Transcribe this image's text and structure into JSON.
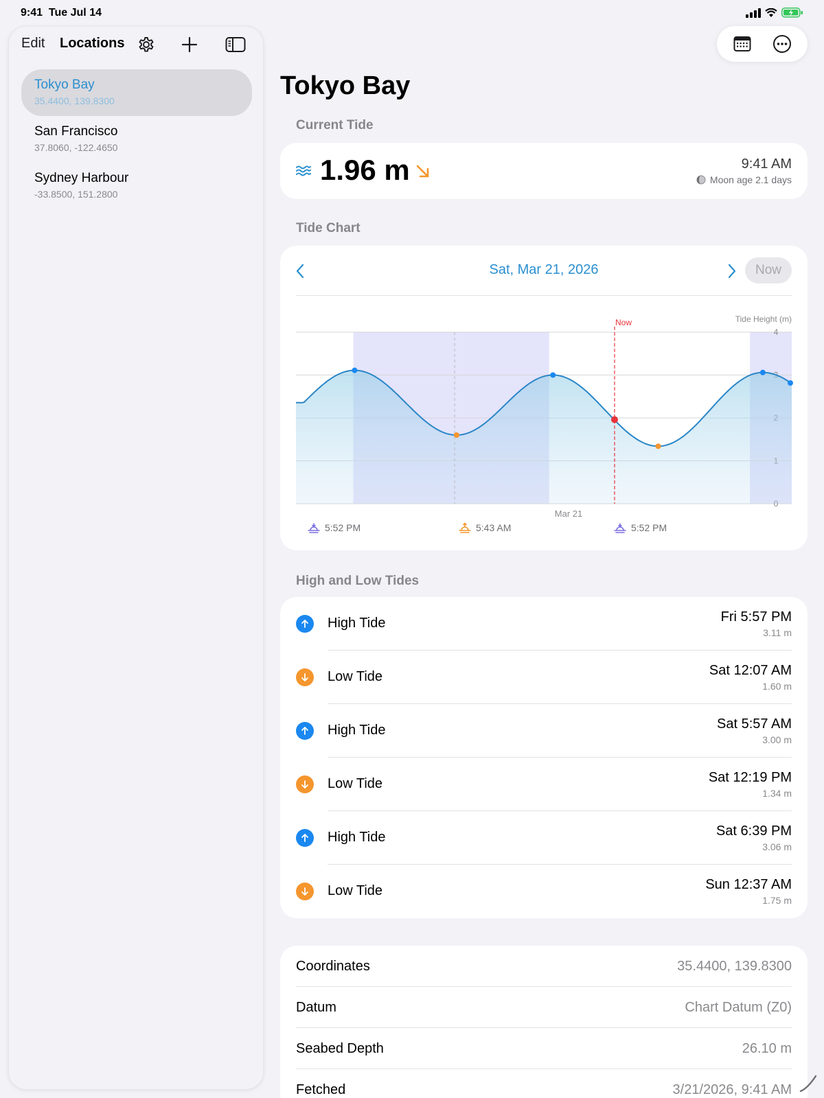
{
  "status_bar": {
    "time": "9:41",
    "date": "Tue Jul 14"
  },
  "sidebar": {
    "edit_label": "Edit",
    "title": "Locations",
    "locations": [
      {
        "name": "Tokyo Bay",
        "coords": "35.4400, 139.8300",
        "selected": true
      },
      {
        "name": "San Francisco",
        "coords": "37.8060, -122.4650",
        "selected": false
      },
      {
        "name": "Sydney Harbour",
        "coords": "-33.8500, 151.2800",
        "selected": false
      }
    ]
  },
  "main": {
    "title": "Tokyo Bay",
    "current_tide": {
      "section_title": "Current Tide",
      "value": "1.96 m",
      "trend": "falling",
      "time": "9:41 AM",
      "moon": "Moon age 2.1 days"
    },
    "tide_chart": {
      "section_title": "Tide Chart",
      "date": "Sat, Mar 21, 2026",
      "now_label": "Now",
      "now_marker_label": "Now",
      "y_axis_title": "Tide Height (m)",
      "x_date_label": "Mar 21",
      "sun_events": [
        {
          "type": "sunset",
          "time": "5:52 PM"
        },
        {
          "type": "sunrise",
          "time": "5:43 AM"
        },
        {
          "type": "sunset",
          "time": "5:52 PM"
        }
      ]
    },
    "high_low": {
      "section_title": "High and Low Tides",
      "rows": [
        {
          "kind": "high",
          "label": "High Tide",
          "time": "Fri 5:57 PM",
          "height": "3.11 m"
        },
        {
          "kind": "low",
          "label": "Low Tide",
          "time": "Sat 12:07 AM",
          "height": "1.60 m"
        },
        {
          "kind": "high",
          "label": "High Tide",
          "time": "Sat 5:57 AM",
          "height": "3.00 m"
        },
        {
          "kind": "low",
          "label": "Low Tide",
          "time": "Sat 12:19 PM",
          "height": "1.34 m"
        },
        {
          "kind": "high",
          "label": "High Tide",
          "time": "Sat 6:39 PM",
          "height": "3.06 m"
        },
        {
          "kind": "low",
          "label": "Low Tide",
          "time": "Sun 12:37 AM",
          "height": "1.75 m"
        }
      ]
    },
    "info": [
      {
        "label": "Coordinates",
        "value": "35.4400, 139.8300"
      },
      {
        "label": "Datum",
        "value": "Chart Datum (Z0)"
      },
      {
        "label": "Seabed Depth",
        "value": "26.10 m"
      },
      {
        "label": "Fetched",
        "value": "3/21/2026, 9:41 AM"
      }
    ]
  },
  "colors": {
    "accent": "#2a8fcf",
    "high": "#1a88f0",
    "low": "#f5962e",
    "now": "#e8333a",
    "night_band": "#e4e4fb",
    "curve": "#2a86c6"
  },
  "chart_data": {
    "type": "area",
    "title": "",
    "xlabel": "Mar 21",
    "ylabel": "Tide Height (m)",
    "x_unit": "hours from midnight Sat Mar 21, 2026",
    "ylim": [
      0,
      4
    ],
    "y_ticks": [
      0,
      1,
      2,
      3,
      4
    ],
    "xlim": [
      -9.6,
      20.4
    ],
    "series": [
      {
        "name": "Tide Height (m)",
        "extremes": [
          {
            "t": -6.05,
            "h": 3.11,
            "kind": "high"
          },
          {
            "t": 0.12,
            "h": 1.6,
            "kind": "low"
          },
          {
            "t": 5.95,
            "h": 3.0,
            "kind": "high"
          },
          {
            "t": 12.32,
            "h": 1.34,
            "kind": "low"
          },
          {
            "t": 18.65,
            "h": 3.06,
            "kind": "high"
          },
          {
            "t": 24.62,
            "h": 1.75,
            "kind": "low"
          }
        ]
      }
    ],
    "now": {
      "t": 9.68,
      "h": 1.96
    },
    "night_bands": [
      [
        -6.13,
        5.72
      ],
      [
        17.87,
        20.4
      ]
    ],
    "midnight_lines": [
      0,
      24
    ],
    "grid": true
  }
}
